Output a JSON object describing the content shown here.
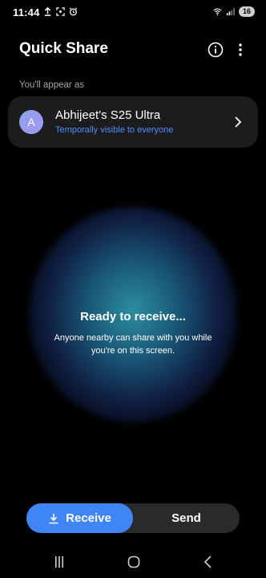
{
  "status_bar": {
    "time": "11:44",
    "battery": "16",
    "left_icons": [
      "upload-arrow-icon",
      "screenshot-icon",
      "alarm-icon"
    ],
    "right_icons": [
      "wifi-icon",
      "signal-icon",
      "battery-icon"
    ]
  },
  "header": {
    "title": "Quick Share",
    "info_icon": "info-icon",
    "more_icon": "more-vertical-icon"
  },
  "appear": {
    "label": "You'll appear as",
    "avatar_letter": "A",
    "device_name": "Abhijeet's S25 Ultra",
    "visibility": "Temporally visible to everyone"
  },
  "ready": {
    "title": "Ready to receive...",
    "description": "Anyone nearby can share with you while you're on this screen."
  },
  "mode_toggle": {
    "receive_label": "Receive",
    "send_label": "Send",
    "selected": "Receive"
  },
  "nav_bar": {
    "icons": [
      "recent-apps-icon",
      "home-icon",
      "back-icon"
    ]
  },
  "colors": {
    "accent": "#3f85f5",
    "link": "#4f8ef7",
    "card": "#1c1c1e",
    "background": "#000000"
  }
}
